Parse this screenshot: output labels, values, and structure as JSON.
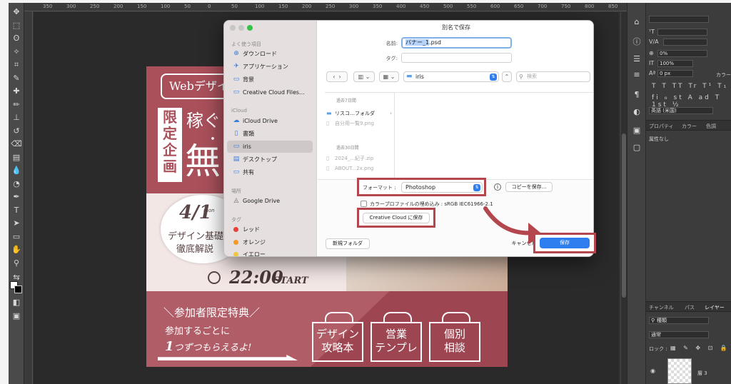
{
  "ruler_ticks": [
    "350",
    "300",
    "250",
    "200",
    "150",
    "100",
    "50",
    "0",
    "50",
    "100",
    "150",
    "200",
    "250",
    "300",
    "350",
    "400",
    "450",
    "500",
    "550",
    "600",
    "650",
    "700",
    "750",
    "800",
    "850"
  ],
  "toolbar_icons": [
    "move-icon",
    "marquee-icon",
    "lasso-icon",
    "magic-wand-icon",
    "crop-icon",
    "eyedropper-icon",
    "healing-icon",
    "brush-icon",
    "stamp-icon",
    "history-brush-icon",
    "eraser-icon",
    "gradient-icon",
    "blur-icon",
    "dodge-icon",
    "pen-icon",
    "type-icon",
    "path-select-icon",
    "rectangle-icon",
    "hand-icon",
    "zoom-icon",
    "more-icon",
    "swap-colors-icon",
    "quick-mask-icon",
    "screen-mode-icon"
  ],
  "panels": {
    "font_size": "100%",
    "tracking": "0%",
    "baseline": "0 px",
    "color_label": "カラー",
    "language": "英語 (米国)",
    "tabs_top": [
      "プロパティ",
      "カラー",
      "色調"
    ],
    "properties_note": "属性なし",
    "tabs_bottom": [
      "チャンネル",
      "パス",
      "レイヤー"
    ],
    "layer_kind": "種類",
    "blend_mode": "通常",
    "lock_label": "ロック :",
    "layer_name": "層 3"
  },
  "banner": {
    "web_tag": "Webデザイ",
    "vertical_label": "限定\n企画",
    "kasegu": "稼ぐし",
    "big_char": "無",
    "date": "4/1",
    "date_sub": "mon",
    "kiso": "デザイン基礎",
    "kaisetsu": "徹底解説",
    "time": "22:00",
    "start": "START",
    "tokuten": "＼参加者限定特典／",
    "sanka": "参加するごとに",
    "hitotsu_num": "1",
    "hitotsu_text": "つずつもらえるよ!",
    "boxes": [
      "デザイン\n攻略本",
      "営業\nテンプレ",
      "個別\n相談"
    ]
  },
  "dialog": {
    "title": "別名で保存",
    "sidebar": {
      "favorites_header": "よく使う項目",
      "favorites": [
        "ダウンロード",
        "アプリケーション",
        "背景",
        "Creative Cloud Files..."
      ],
      "icloud_header": "iCloud",
      "icloud": [
        "iCloud Drive",
        "書類",
        "iris",
        "デスクトップ",
        "共有"
      ],
      "places_header": "場所",
      "places": [
        "Google Drive"
      ],
      "tags_header": "タグ",
      "tags": [
        {
          "label": "レッド",
          "color": "#e5403a"
        },
        {
          "label": "オレンジ",
          "color": "#f39a2b"
        },
        {
          "label": "イエロー",
          "color": "#f2c53c"
        }
      ]
    },
    "name_label": "名前:",
    "name_selected": "バナー_1",
    "name_suffix": ".psd",
    "tag_label": "タグ:",
    "location": "iris",
    "search_placeholder": "検索",
    "browser": {
      "section1": "過去7日間",
      "items1": [
        {
          "label": "リスコ…フォルダ",
          "dim": false,
          "folder": true
        },
        {
          "label": "自分用一覧9.png",
          "dim": true,
          "folder": false
        }
      ],
      "section2": "過去30日間",
      "items2": [
        {
          "label": "2024_...紀子.zip",
          "dim": true,
          "folder": false
        },
        {
          "label": "ABOUT...2x.png",
          "dim": true,
          "folder": false
        }
      ]
    },
    "format_label": "フォーマット :",
    "format_value": "Photoshop",
    "copy_button": "コピーを保存...",
    "color_profile_label": "カラープロファイルの埋め込み : sRGB IEC61966-2.1",
    "cc_button": "Creative Cloud に保存",
    "new_folder_button": "新規フォルダ",
    "cancel_button": "キャンセル",
    "save_button": "保存"
  },
  "colors": {
    "highlight": "#b4474d",
    "accent_blue": "#2f7ef0",
    "banner_top": "#a9505b",
    "banner_bottom": "#b15d67"
  }
}
